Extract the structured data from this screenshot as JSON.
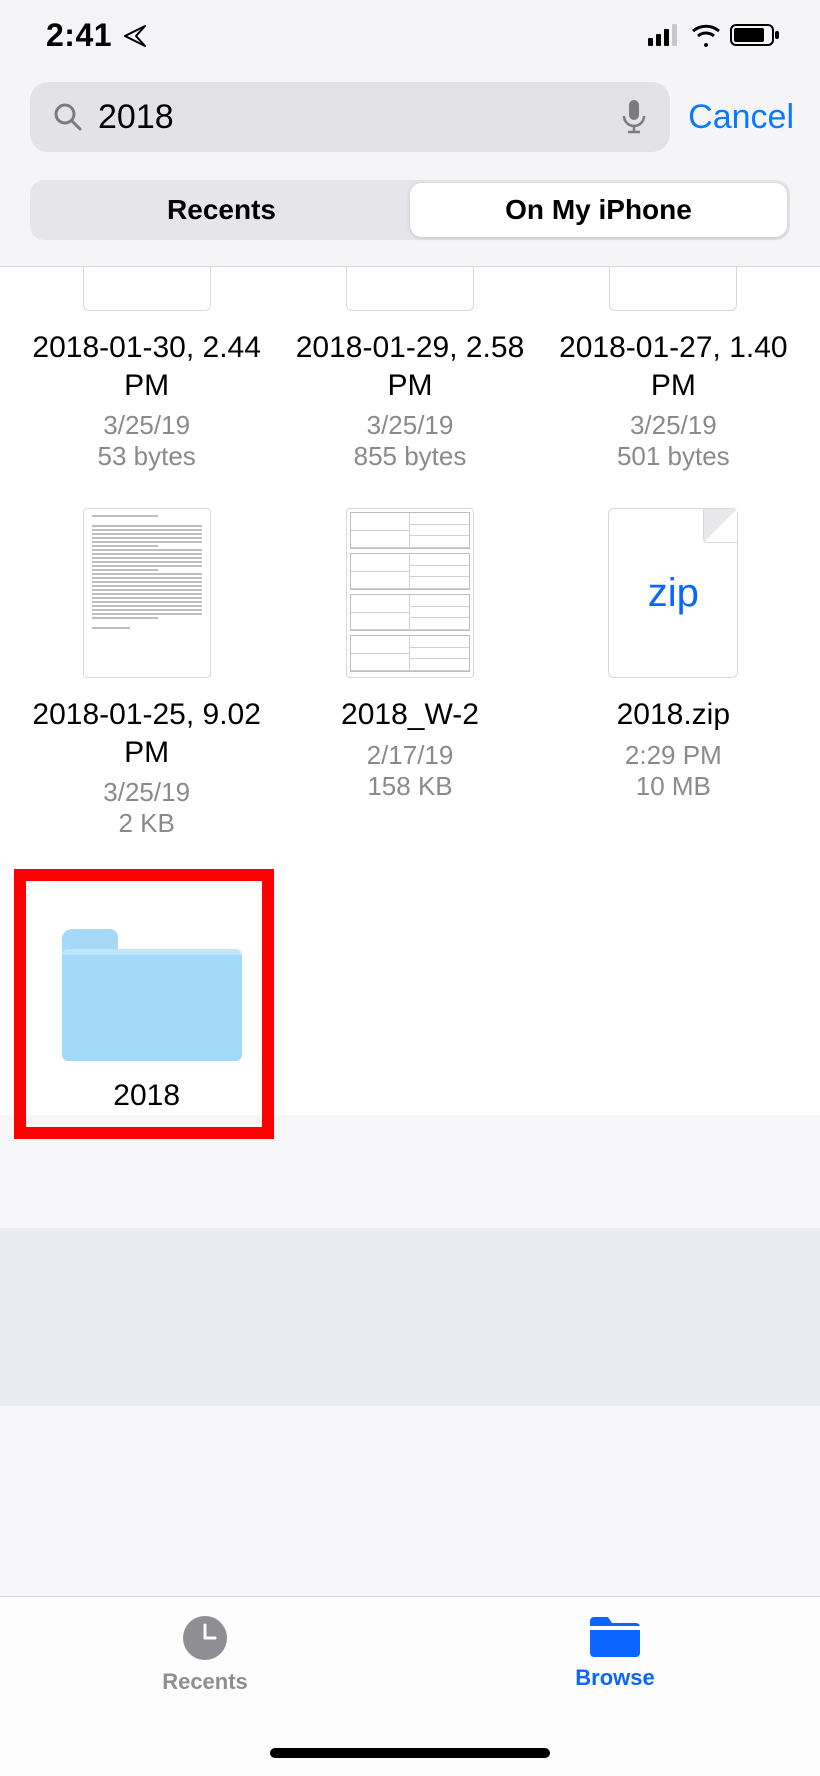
{
  "status": {
    "time": "2:41"
  },
  "search": {
    "value": "2018"
  },
  "cancel_label": "Cancel",
  "scope": {
    "option_a": "Recents",
    "option_b": "On My iPhone",
    "active": "option_b"
  },
  "items": [
    {
      "name": "2018-01-30, 2.44 PM",
      "date": "3/25/19",
      "size": "53 bytes",
      "kind": "partial"
    },
    {
      "name": "2018-01-29, 2.58 PM",
      "date": "3/25/19",
      "size": "855 bytes",
      "kind": "partial"
    },
    {
      "name": "2018-01-27, 1.40 PM",
      "date": "3/25/19",
      "size": "501 bytes",
      "kind": "partial"
    },
    {
      "name": "2018-01-25, 9.02 PM",
      "date": "3/25/19",
      "size": "2 KB",
      "kind": "textdoc"
    },
    {
      "name": "2018_W-2",
      "date": "2/17/19",
      "size": "158 KB",
      "kind": "formdoc"
    },
    {
      "name": "2018.zip",
      "date": "2:29 PM",
      "size": "10 MB",
      "kind": "zip"
    },
    {
      "name": "2018",
      "date": "",
      "size": "",
      "kind": "folder",
      "highlighted": true
    }
  ],
  "tabs": {
    "recents": "Recents",
    "browse": "Browse",
    "active": "browse"
  },
  "zip_label": "zip"
}
